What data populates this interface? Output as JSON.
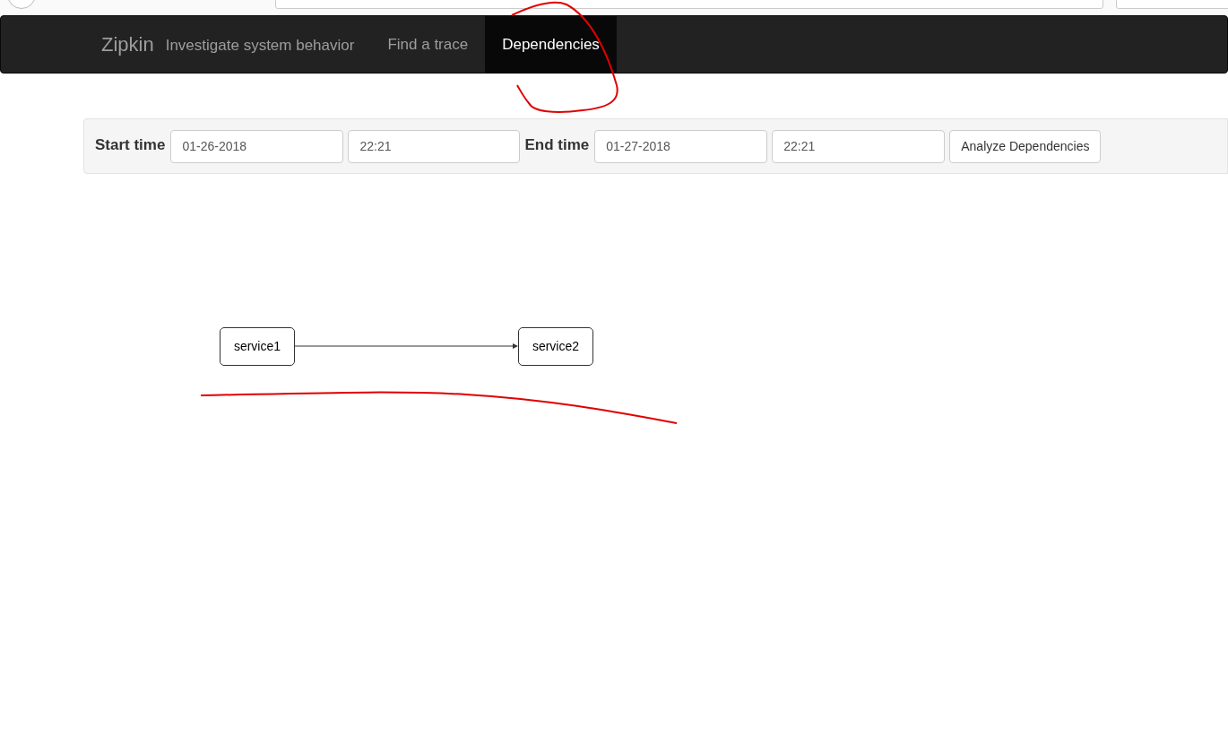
{
  "navbar": {
    "brand": "Zipkin",
    "tagline": "Investigate system behavior",
    "tabs": [
      {
        "label": "Find a trace",
        "selected": false
      },
      {
        "label": "Dependencies",
        "selected": true
      }
    ]
  },
  "query_form": {
    "start_label": "Start time",
    "start_date": "01-26-2018",
    "start_time": "22:21",
    "end_label": "End time",
    "end_date": "01-27-2018",
    "end_time": "22:21",
    "button": "Analyze Dependencies"
  },
  "dependency_graph": {
    "nodes": [
      {
        "label": "service1",
        "calls_next": true
      },
      {
        "label": "service2"
      }
    ]
  }
}
